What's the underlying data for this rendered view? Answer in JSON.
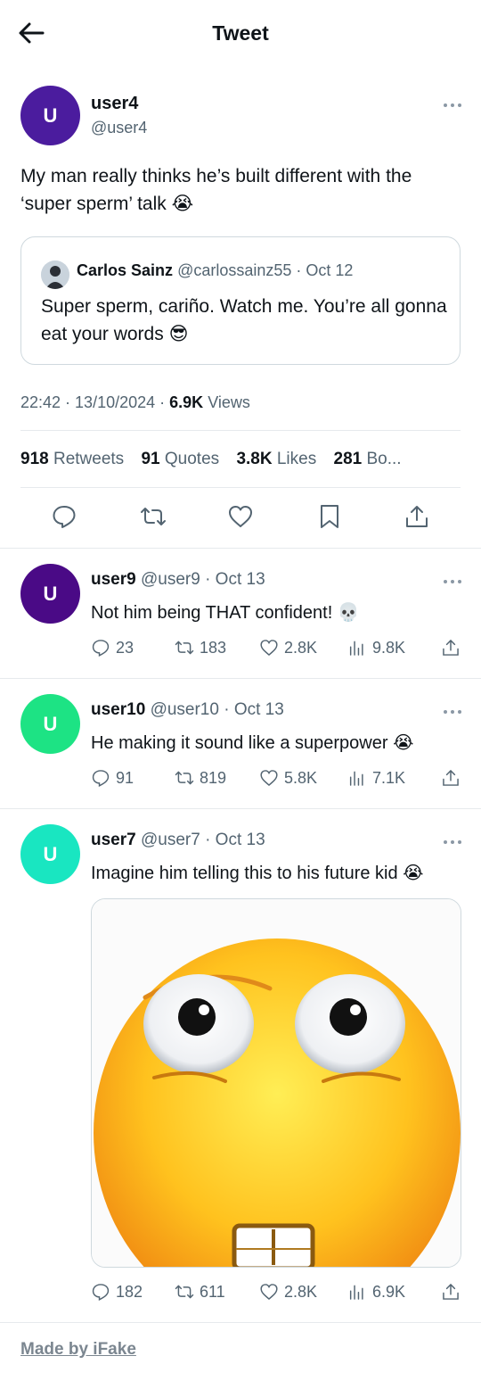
{
  "header": {
    "title": "Tweet",
    "back_icon": "arrow-left-icon"
  },
  "tweet": {
    "avatar_letter": "U",
    "avatar_color": "#4b1c9e",
    "name": "user4",
    "handle": "@user4",
    "text": "My man really thinks he’s built different with the ‘super sperm’ talk 😭",
    "quote": {
      "name": "Carlos Sainz",
      "handle": "@carlossainz55",
      "sep": " · ",
      "date": "Oct 12",
      "text": "Super sperm, cariño. Watch me. You’re all gonna eat your words 😎"
    },
    "time": "22:42",
    "date": "13/10/2024",
    "views_count": "6.9K",
    "views_label": "Views",
    "stats": {
      "retweets_count": "918",
      "retweets_label": "Retweets",
      "quotes_count": "91",
      "quotes_label": "Quotes",
      "likes_count": "3.8K",
      "likes_label": "Likes",
      "bookmarks_count": "281",
      "bookmarks_label": "Bo..."
    }
  },
  "replies": [
    {
      "avatar_letter": "U",
      "avatar_color": "#4a0a86",
      "name": "user9",
      "meta": "@user9 · Oct 13",
      "text": "Not him being THAT confident! 💀",
      "replies": "23",
      "retweets": "183",
      "likes": "2.8K",
      "views": "9.8K"
    },
    {
      "avatar_letter": "U",
      "avatar_color": "#1de384",
      "name": "user10",
      "meta": "@user10 · Oct 13",
      "text": "He making it sound like a superpower 😭",
      "replies": "91",
      "retweets": "819",
      "likes": "5.8K",
      "views": "7.1K"
    },
    {
      "avatar_letter": "U",
      "avatar_color": "#19e6c1",
      "name": "user7",
      "meta": "@user7 · Oct 13",
      "text": "Imagine him telling this to his future kid 😭",
      "replies": "182",
      "retweets": "611",
      "likes": "2.8K",
      "views": "6.9K"
    }
  ],
  "footer": {
    "text": "Made by iFake"
  }
}
